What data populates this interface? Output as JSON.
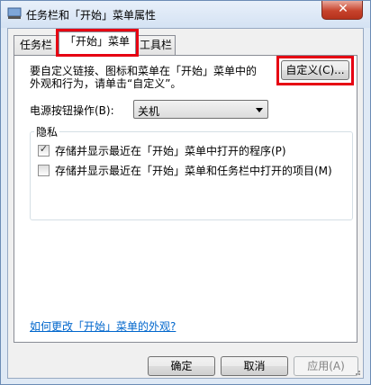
{
  "window": {
    "title": "任务栏和「开始」菜单属性",
    "close_label": "✕"
  },
  "tabs": [
    {
      "label": "任务栏"
    },
    {
      "label": "「开始」菜单"
    },
    {
      "label": "工具栏"
    }
  ],
  "start_menu": {
    "description_line1": "要自定义链接、图标和菜单在「开始」菜单中的",
    "description_line2": "外观和行为，请单击“自定义”。",
    "customize_button": "自定义(C)...",
    "power_label": "电源按钮操作(B):",
    "power_value": "关机",
    "privacy_title": "隐私",
    "privacy_items": [
      {
        "label": "存储并显示最近在「开始」菜单中打开的程序(P)",
        "checked": true
      },
      {
        "label": "存储并显示最近在「开始」菜单和任务栏中打开的项目(M)",
        "checked": false
      }
    ],
    "help_link": "如何更改「开始」菜单的外观?"
  },
  "buttons": {
    "ok": "确定",
    "cancel": "取消",
    "apply": "应用(A)"
  },
  "colors": {
    "highlight": "#e60012",
    "link": "#0066cc"
  },
  "icons": {
    "title": "taskbar-properties-icon",
    "close": "close-icon",
    "check": "check-icon",
    "dropdown": "chevron-down-icon"
  }
}
